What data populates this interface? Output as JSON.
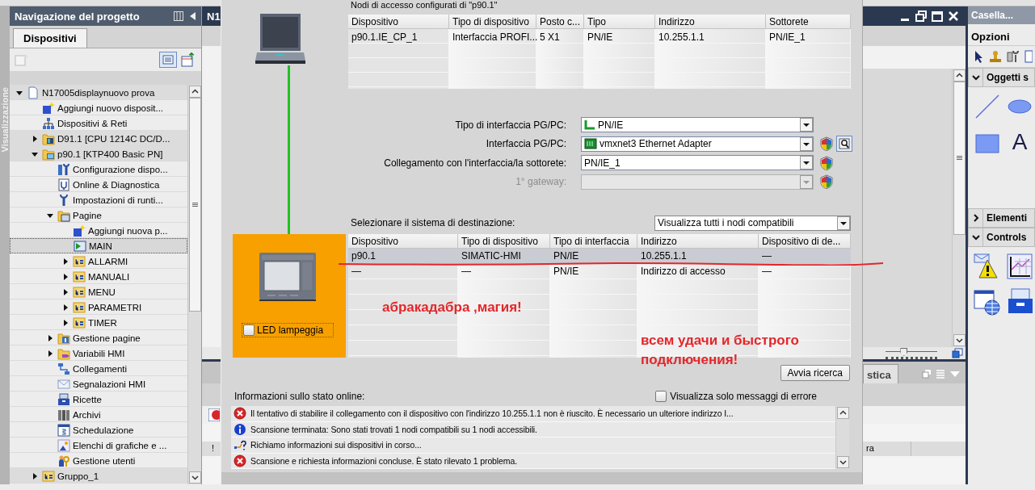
{
  "side_strip": {
    "label": "Visualizzazione"
  },
  "project_navigation": {
    "title": "Navigazione del progetto",
    "tabs": [
      {
        "label": "Dispositivi",
        "selected": true
      }
    ],
    "tree": [
      {
        "label": "N17005displaynuovo prova",
        "kind": "document",
        "expanded": true,
        "selected": false,
        "children": [
          {
            "label": "Aggiungi nuovo disposit...",
            "kind": "add",
            "selected": false
          },
          {
            "label": "Dispositivi & Reti",
            "kind": "network",
            "selected": false
          },
          {
            "label": "D91.1 [CPU 1214C DC/D...",
            "kind": "plc-folder",
            "expanded": false,
            "selected": false
          },
          {
            "label": "p90.1 [KTP400 Basic PN]",
            "kind": "hmi-folder",
            "expanded": true,
            "selected": false,
            "children": [
              {
                "label": "Configurazione dispo...",
                "kind": "config",
                "selected": false
              },
              {
                "label": "Online & Diagnostica",
                "kind": "diagnostics",
                "selected": false
              },
              {
                "label": "Impostazioni di runti...",
                "kind": "wrench",
                "selected": false
              },
              {
                "label": "Pagine",
                "kind": "folder",
                "expanded": true,
                "selected": false,
                "children": [
                  {
                    "label": "Aggiungi nuova p...",
                    "kind": "add",
                    "selected": false
                  },
                  {
                    "label": "MAIN",
                    "kind": "screen",
                    "selected": true
                  },
                  {
                    "label": "ALLARMI",
                    "kind": "group-folder",
                    "expanded": false,
                    "selected": false
                  },
                  {
                    "label": "MANUALI",
                    "kind": "group-folder",
                    "expanded": false,
                    "selected": false
                  },
                  {
                    "label": "MENU",
                    "kind": "group-folder",
                    "expanded": false,
                    "selected": false
                  },
                  {
                    "label": "PARAMETRI",
                    "kind": "group-folder",
                    "expanded": false,
                    "selected": false
                  },
                  {
                    "label": "TIMER",
                    "kind": "group-folder",
                    "expanded": false,
                    "selected": false
                  }
                ]
              },
              {
                "label": "Gestione pagine",
                "kind": "management-folder",
                "expanded": false,
                "selected": false
              },
              {
                "label": "Variabili HMI",
                "kind": "tags-folder",
                "expanded": false,
                "selected": false
              },
              {
                "label": "Collegamenti",
                "kind": "connections",
                "selected": false
              },
              {
                "label": "Segnalazioni HMI",
                "kind": "envelope",
                "selected": false
              },
              {
                "label": "Ricette",
                "kind": "recipes",
                "selected": false
              },
              {
                "label": "Archivi",
                "kind": "archives",
                "selected": false
              },
              {
                "label": "Schedulazione",
                "kind": "calendar",
                "selected": false
              },
              {
                "label": "Elenchi di grafiche e ...",
                "kind": "graphics",
                "selected": false
              },
              {
                "label": "Gestione utenti",
                "kind": "users",
                "selected": false
              }
            ]
          },
          {
            "label": "Gruppo_1",
            "kind": "group-folder",
            "expanded": false,
            "selected": false
          }
        ]
      }
    ]
  },
  "editor": {
    "title": "N1",
    "zoom": {
      "level": 0.35
    },
    "inspector_tab": "stica",
    "inspector_fragment": "!",
    "inspector_column": "ra"
  },
  "dialog": {
    "configured_nodes": {
      "title": "Nodi di accesso configurati di \"p90.1\"",
      "columns": [
        "Dispositivo",
        "Tipo di dispositivo",
        "Posto c...",
        "Tipo",
        "Indirizzo",
        "Sottorete"
      ],
      "rows": [
        [
          "p90.1.IE_CP_1",
          "Interfaccia PROFI...",
          "5 X1",
          "PN/IE",
          "10.255.1.1",
          "PN/IE_1"
        ]
      ]
    },
    "settings": [
      {
        "label": "Tipo di interfaccia PG/PC:",
        "value": "PN/IE",
        "kind": "port",
        "disabled": false,
        "shield": false,
        "properties_button": false
      },
      {
        "label": "Interfaccia PG/PC:",
        "value": "vmxnet3 Ethernet Adapter",
        "kind": "adapter",
        "disabled": false,
        "shield": true,
        "properties_button": true
      },
      {
        "label": "Collegamento con l'interfaccia/la sottorete:",
        "value": "PN/IE_1",
        "disabled": false,
        "shield": true,
        "properties_button": false
      },
      {
        "label": "1° gateway:",
        "disabled": true,
        "shield": true,
        "properties_button": false
      }
    ],
    "target": {
      "label": "Selezionare il sistema di destinazione:",
      "filter": "Visualizza tutti i nodi compatibili",
      "columns": [
        "Dispositivo",
        "Tipo di dispositivo",
        "Tipo di interfaccia",
        "Indirizzo",
        "Dispositivo di de..."
      ],
      "rows": [
        {
          "cells": [
            "p90.1",
            "SIMATIC-HMI",
            "PN/IE",
            "10.255.1.1",
            "—"
          ],
          "selected": true
        },
        {
          "cells": [
            "—",
            "—",
            "PN/IE",
            "Indirizzo di accesso",
            "—"
          ],
          "selected": false
        }
      ]
    },
    "led": {
      "label": "LED lampeggia",
      "checked": false
    },
    "search_button": "Avvia ricerca",
    "status": {
      "label": "Informazioni sullo stato online:",
      "errors_only": {
        "label": "Visualizza solo messaggi di errore",
        "checked": false
      },
      "messages": [
        {
          "kind": "error",
          "text": "Il tentativo di stabilire il collegamento con il dispositivo con l'indirizzo 10.255.1.1 non è riuscito. È necessario un ulteriore indirizzo I..."
        },
        {
          "kind": "info",
          "text": "Scansione terminata: Sono stati trovati 1 nodi compatibili su 1 nodi accessibili."
        },
        {
          "kind": "progress",
          "text": "Richiamo informazioni sui dispositivi in corso..."
        },
        {
          "kind": "error",
          "text": "Scansione e richiesta informazioni concluse. È stato rilevato 1 problema."
        }
      ]
    }
  },
  "annotations": [
    {
      "text": "абракадабра ,магия!"
    },
    {
      "text": "всем удачи и быстрого подключения!"
    }
  ],
  "tasks": {
    "title": "Casella...",
    "subtitle": "Opzioni",
    "sections": [
      {
        "title": "Oggetti s",
        "expanded": true,
        "tools": [
          {
            "kind": "line"
          },
          {
            "kind": "ellipse"
          },
          {
            "kind": "rectangle"
          },
          {
            "kind": "text",
            "label": "A"
          }
        ]
      },
      {
        "title": "Elementi",
        "expanded": false
      },
      {
        "title": "Controls",
        "expanded": true,
        "tools": [
          {
            "kind": "alarm-view"
          },
          {
            "kind": "trend-view"
          },
          {
            "kind": "web-browser"
          },
          {
            "kind": "recipe-view"
          }
        ]
      }
    ]
  }
}
